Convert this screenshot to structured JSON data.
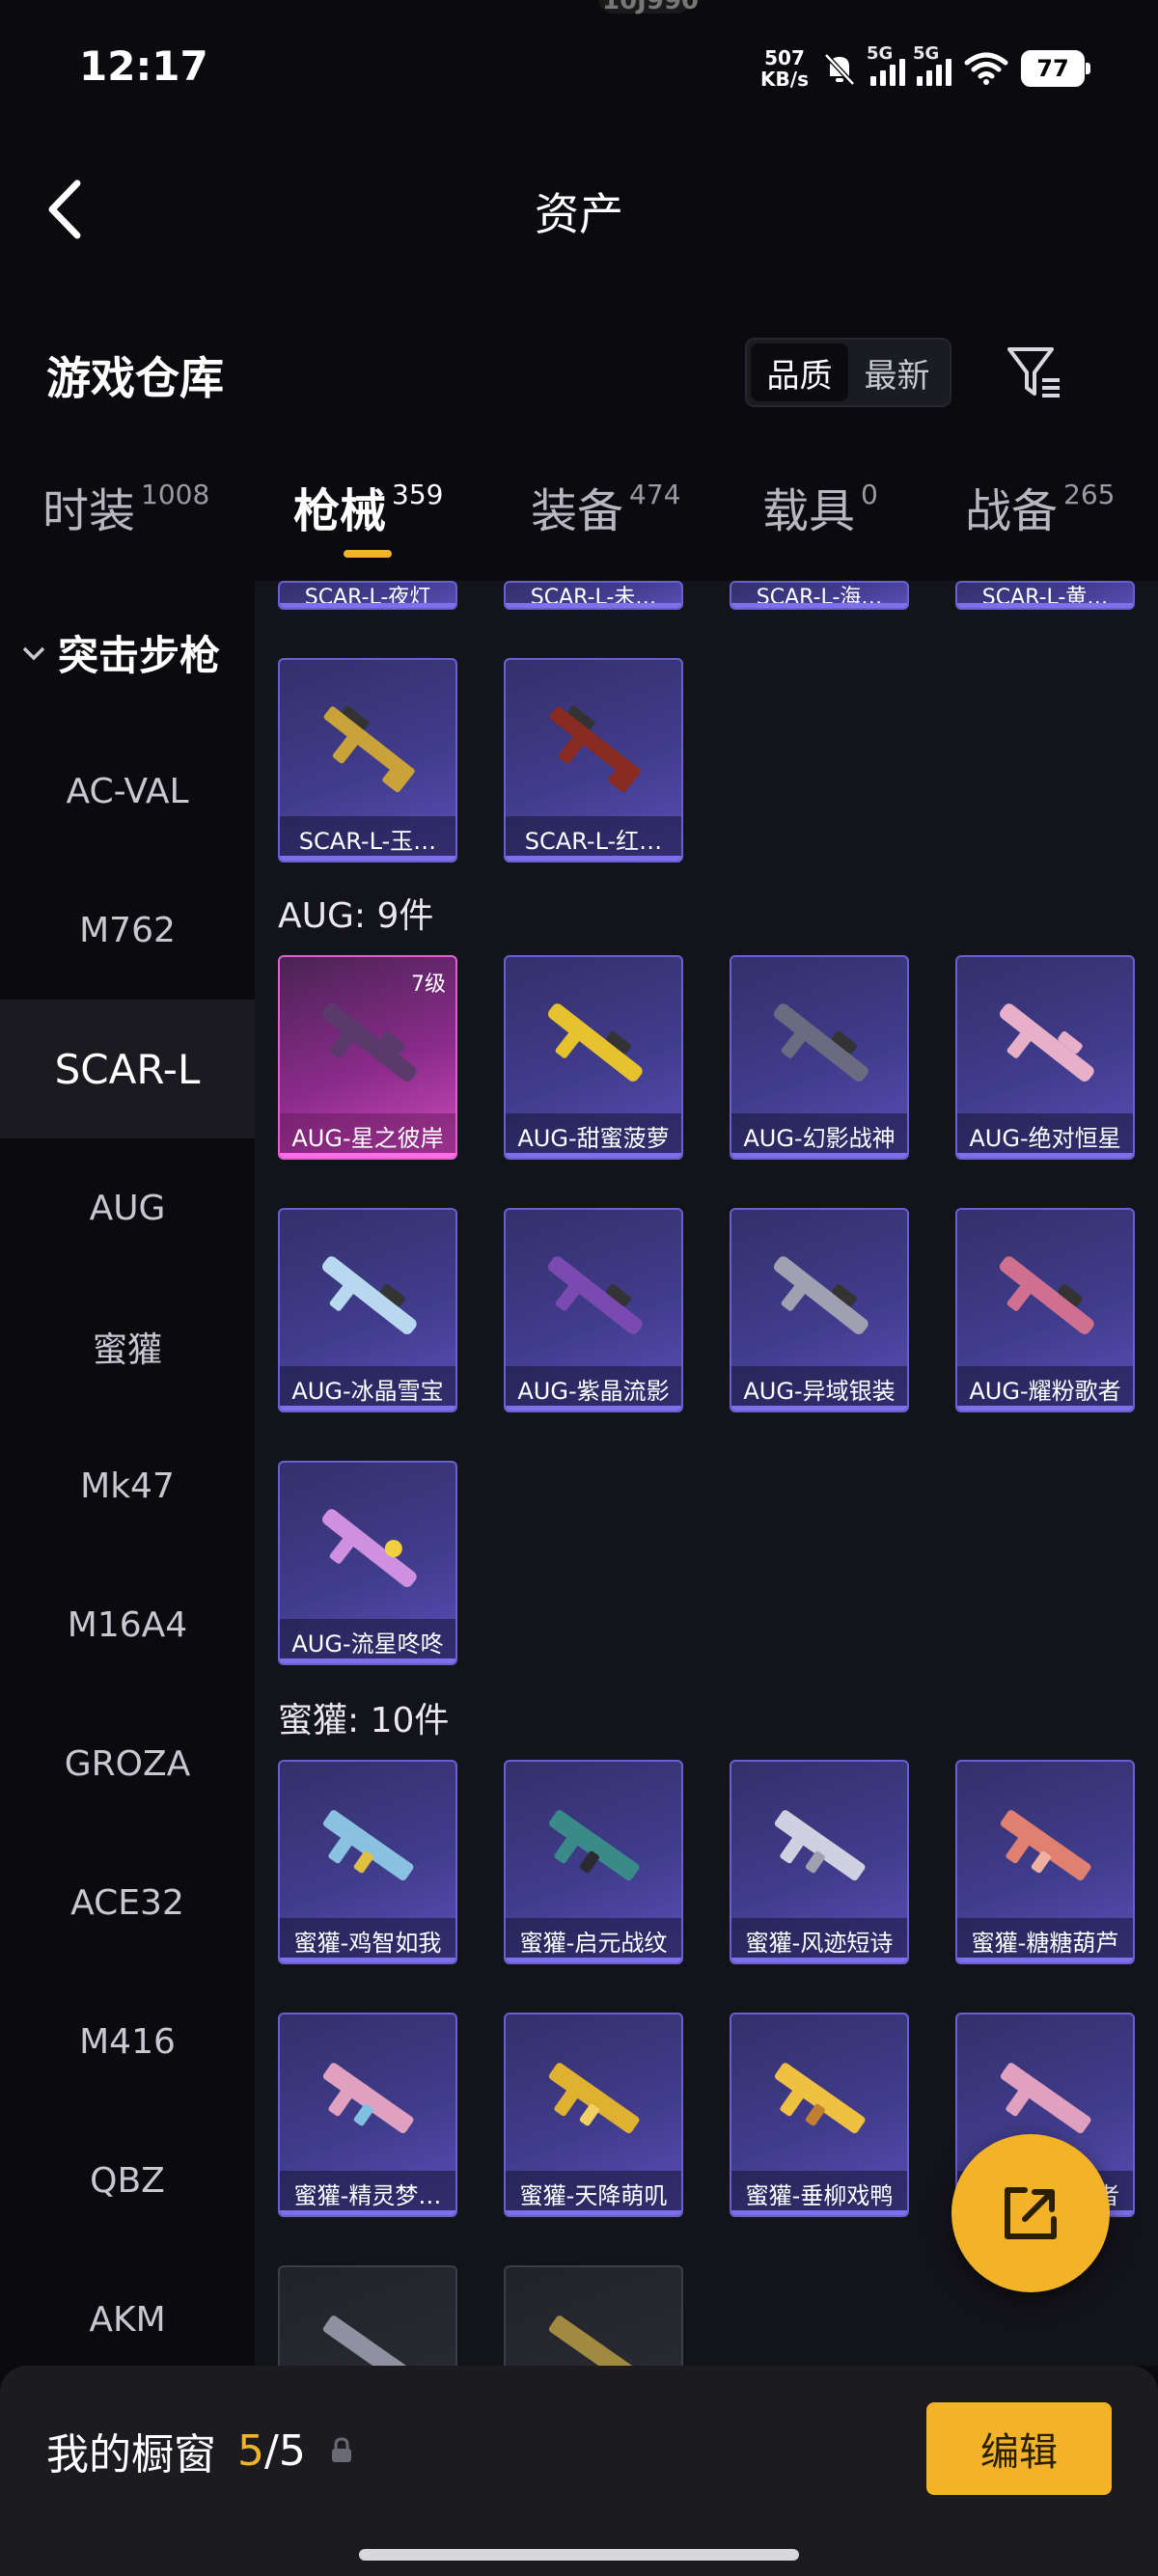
{
  "status_bar": {
    "time": "12:17",
    "top_cut_text": "10J990",
    "speed_value": "507",
    "speed_unit": "KB/s",
    "sim1_label": "5G",
    "sim2_label": "5G",
    "battery": "77"
  },
  "header": {
    "title": "资产"
  },
  "warehouse": {
    "title": "游戏仓库",
    "sort_options": [
      "品质",
      "最新"
    ],
    "active_sort": "品质"
  },
  "tabs": [
    {
      "label": "时装",
      "count": "1008"
    },
    {
      "label": "枪械",
      "count": "359"
    },
    {
      "label": "装备",
      "count": "474"
    },
    {
      "label": "载具",
      "count": "0"
    },
    {
      "label": "战备",
      "count": "265"
    }
  ],
  "active_tab": "枪械",
  "sidebar": {
    "category": "突击步枪",
    "items": [
      "AC-VAL",
      "M762",
      "SCAR-L",
      "AUG",
      "蜜獾",
      "Mk47",
      "M16A4",
      "GROZA",
      "ACE32",
      "M416",
      "QBZ",
      "AKM"
    ],
    "active": "SCAR-L"
  },
  "content": {
    "top_partial": [
      "SCAR-L-夜灯",
      "SCAR-L-未…",
      "SCAR-L-海…",
      "SCAR-L-黄…"
    ],
    "scar_rest": [
      "SCAR-L-玉…",
      "SCAR-L-红…"
    ],
    "aug_title": "AUG: 9件",
    "aug_items": [
      {
        "name": "AUG-星之彼岸",
        "level": "7级",
        "rarity": "pink"
      },
      {
        "name": "AUG-甜蜜菠萝",
        "rarity": "purple"
      },
      {
        "name": "AUG-幻影战神",
        "rarity": "purple"
      },
      {
        "name": "AUG-绝对恒星",
        "rarity": "purple"
      },
      {
        "name": "AUG-冰晶雪宝",
        "rarity": "purple"
      },
      {
        "name": "AUG-紫晶流影",
        "rarity": "purple"
      },
      {
        "name": "AUG-异域银装",
        "rarity": "purple"
      },
      {
        "name": "AUG-耀粉歌者",
        "rarity": "purple"
      },
      {
        "name": "AUG-流星咚咚",
        "rarity": "purple"
      }
    ],
    "honey_title": "蜜獾: 10件",
    "honey_items": [
      "蜜獾-鸡智如我",
      "蜜獾-启元战纹",
      "蜜獾-风迹短诗",
      "蜜獾-糖糖葫芦",
      "蜜獾-精灵梦…",
      "蜜獾-天降萌叽",
      "蜜獾-垂柳戏鸭",
      "者"
    ]
  },
  "gun_colors": {
    "scar_gold": "#c9a23a",
    "scar_red": "#8a2b22",
    "aug_pink": "#5a3a6a",
    "aug_yellow": "#e6c22e",
    "aug_dark": "#6a6a80",
    "aug_blush": "#e8b0c8",
    "aug_ice": "#b8d8f0",
    "aug_violet": "#7a4ab0",
    "aug_silver": "#a0a0b0",
    "aug_rose": "#d07090",
    "aug_lilac": "#d090e0",
    "honey_sky": "#8ac0e0",
    "honey_teal": "#3a8a8a",
    "honey_white": "#d0d0e0",
    "honey_coral": "#e08070",
    "honey_candy": "#e0a0c0",
    "honey_gold": "#e0b030",
    "honey_yellow": "#f0c040"
  },
  "bottom_bar": {
    "label": "我的橱窗",
    "current": "5",
    "total": "/5",
    "edit_label": "编辑"
  }
}
